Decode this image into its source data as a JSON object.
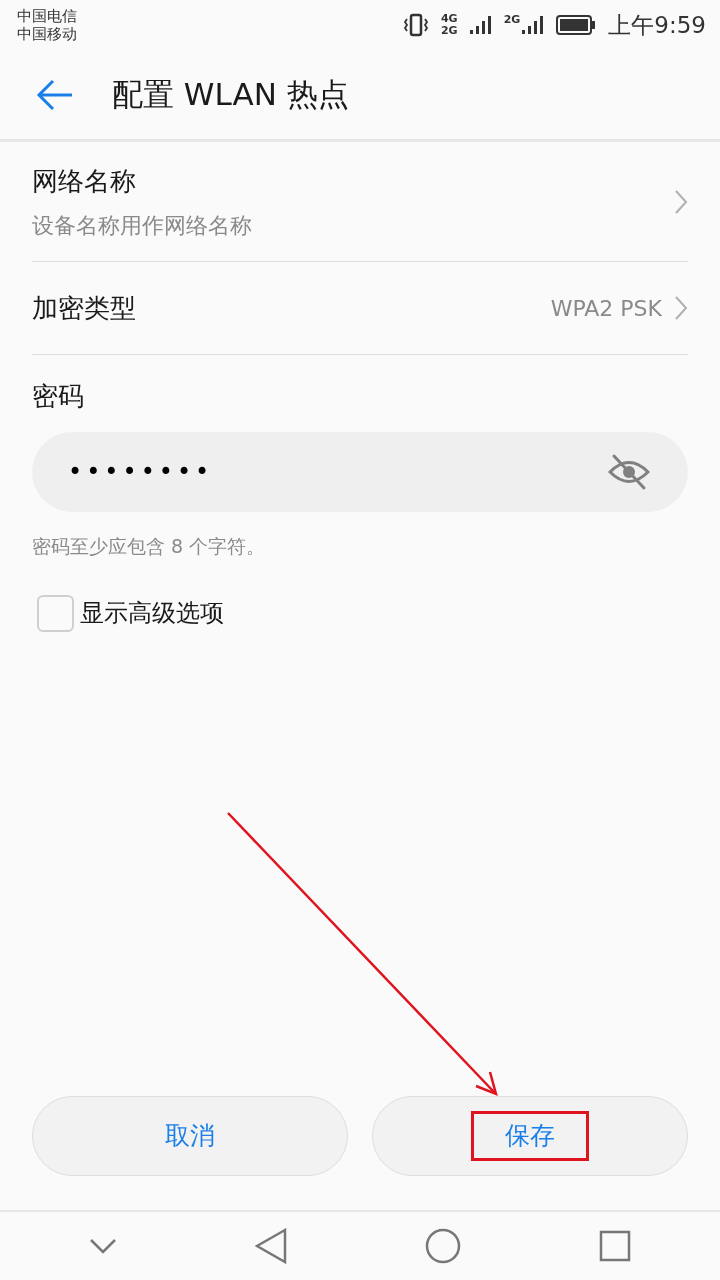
{
  "status_bar": {
    "carriers": [
      "中国电信",
      "中国移动"
    ],
    "network_1": "4G",
    "network_2": "2G",
    "network_3": "2G",
    "time": "上午9:59"
  },
  "app_bar": {
    "title": "配置 WLAN 热点"
  },
  "settings": [
    {
      "kind": "link",
      "label": "网络名称",
      "subtitle": "设备名称用作网络名称"
    },
    {
      "kind": "value",
      "label": "加密类型",
      "value": "WPA2 PSK"
    }
  ],
  "password": {
    "label": "密码",
    "value": "••••••••",
    "visible": false,
    "hint": "密码至少应包含 8 个字符。"
  },
  "advanced": {
    "label": "显示高级选项",
    "checked": false
  },
  "buttons": [
    {
      "label": "取消",
      "highlighted": false
    },
    {
      "label": "保存",
      "highlighted": true
    }
  ]
}
